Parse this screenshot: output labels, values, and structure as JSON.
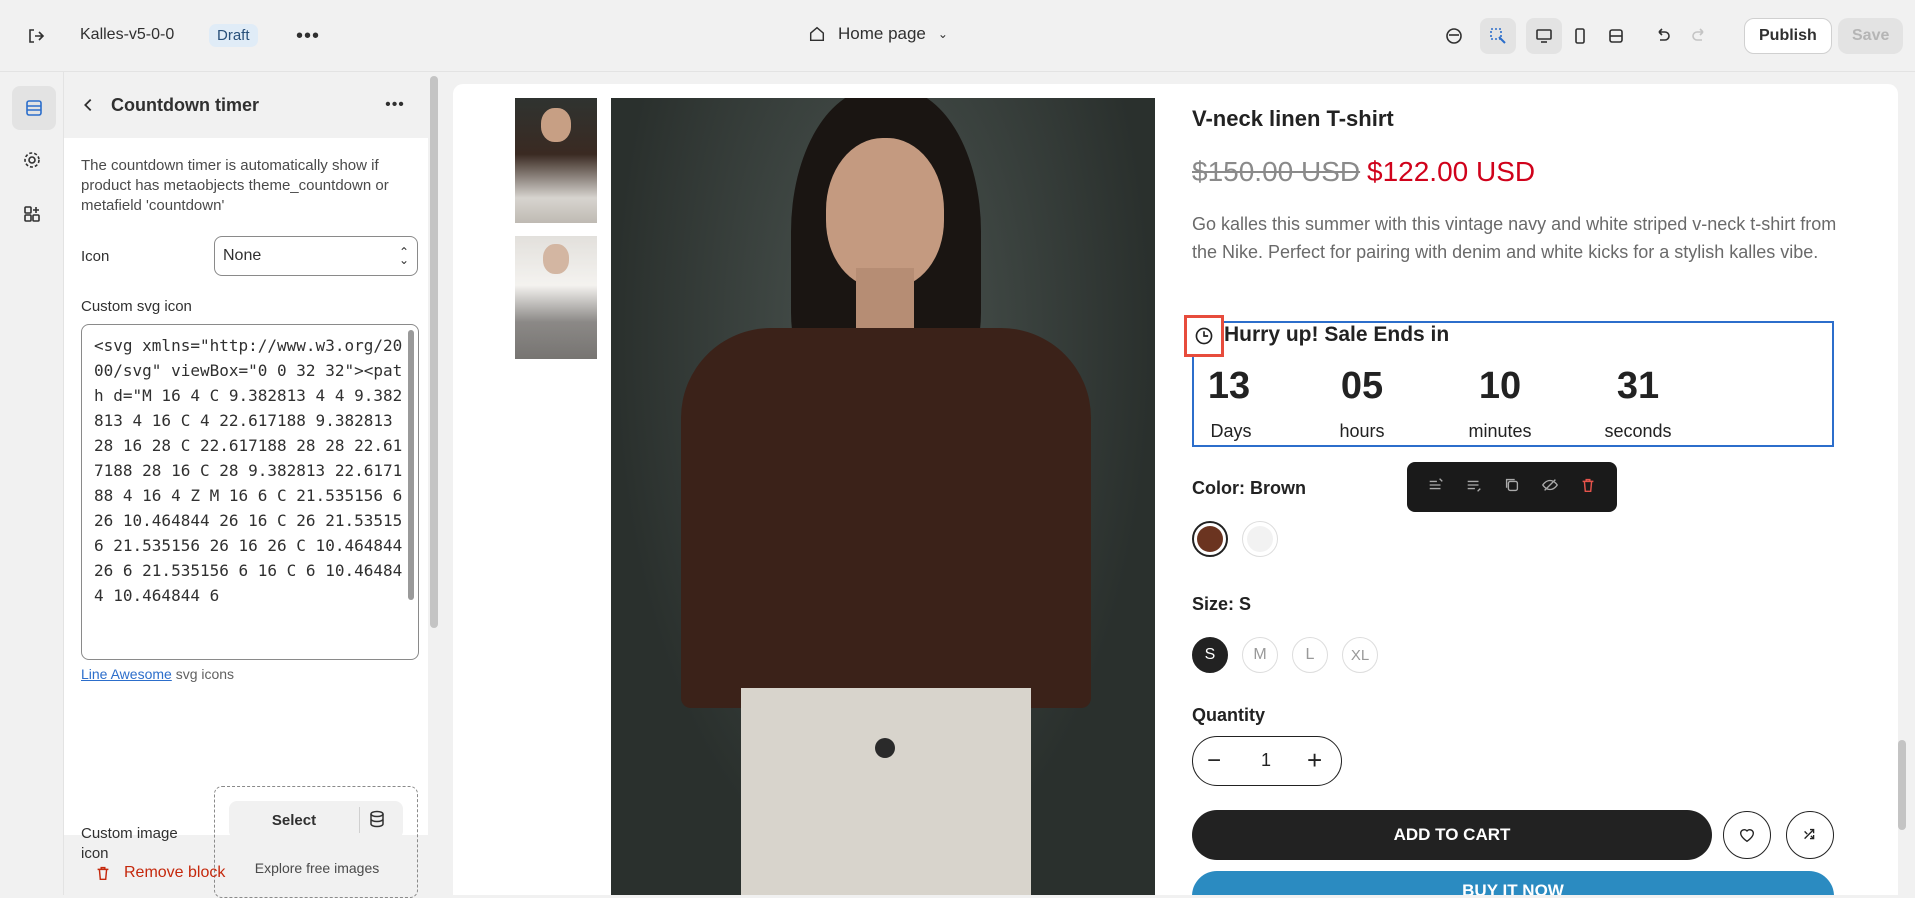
{
  "topbar": {
    "store_name": "Kalles-v5-0-0",
    "status_badge": "Draft",
    "page_selector": "Home page",
    "publish_label": "Publish",
    "save_label": "Save"
  },
  "panel": {
    "title": "Countdown timer",
    "description": "The countdown timer is automatically show if product has metaobjects theme_countdown or metafield 'countdown'",
    "icon_label": "Icon",
    "icon_value": "None",
    "custom_svg_label": "Custom svg icon",
    "custom_svg_value": "<svg xmlns=\"http://www.w3.org/2000/svg\" viewBox=\"0 0 32 32\"><path d=\"M 16 4 C 9.382813 4 4 9.382813 4 16 C 4 22.617188 9.382813 28 16 28 C 22.617188 28 28 22.617188 28 16 C 28 9.382813 22.617188 4 16 4 Z M 16 6 C 21.535156 6 26 10.464844 26 16 C 26 21.535156 21.535156 26 16 26 C 10.464844 26 6 21.535156 6 16 C 6 10.464844 10.464844 6",
    "help_link": "Line Awesome",
    "help_text": "svg icons",
    "custom_image_label": "Custom image icon",
    "select_label": "Select",
    "explore_label": "Explore free images",
    "remove_label": "Remove block"
  },
  "product": {
    "title": "V-neck linen T-shirt",
    "compare_price": "$150.00 USD",
    "price": "$122.00 USD",
    "description": "Go kalles this summer with this vintage navy and white striped v-neck t-shirt from the Nike. Perfect for pairing with denim and white kicks for a stylish kalles vibe.",
    "countdown_heading": "Hurry up! Sale Ends in",
    "countdown": [
      {
        "value": "13",
        "unit": "Days"
      },
      {
        "value": "05",
        "unit": "hours"
      },
      {
        "value": "10",
        "unit": "minutes"
      },
      {
        "value": "31",
        "unit": "seconds"
      }
    ],
    "color_label": "Color: Brown",
    "size_label": "Size: S",
    "sizes": [
      "S",
      "M",
      "L",
      "XL"
    ],
    "quantity_label": "Quantity",
    "quantity_value": "1",
    "add_to_cart": "ADD TO CART",
    "buy_now": "BUY IT NOW"
  },
  "colors": {
    "accent_blue": "#2c6ecb",
    "price_red": "#d0021b",
    "swatch_brown": "#6b3420",
    "highlight_red": "#e74c3c"
  }
}
